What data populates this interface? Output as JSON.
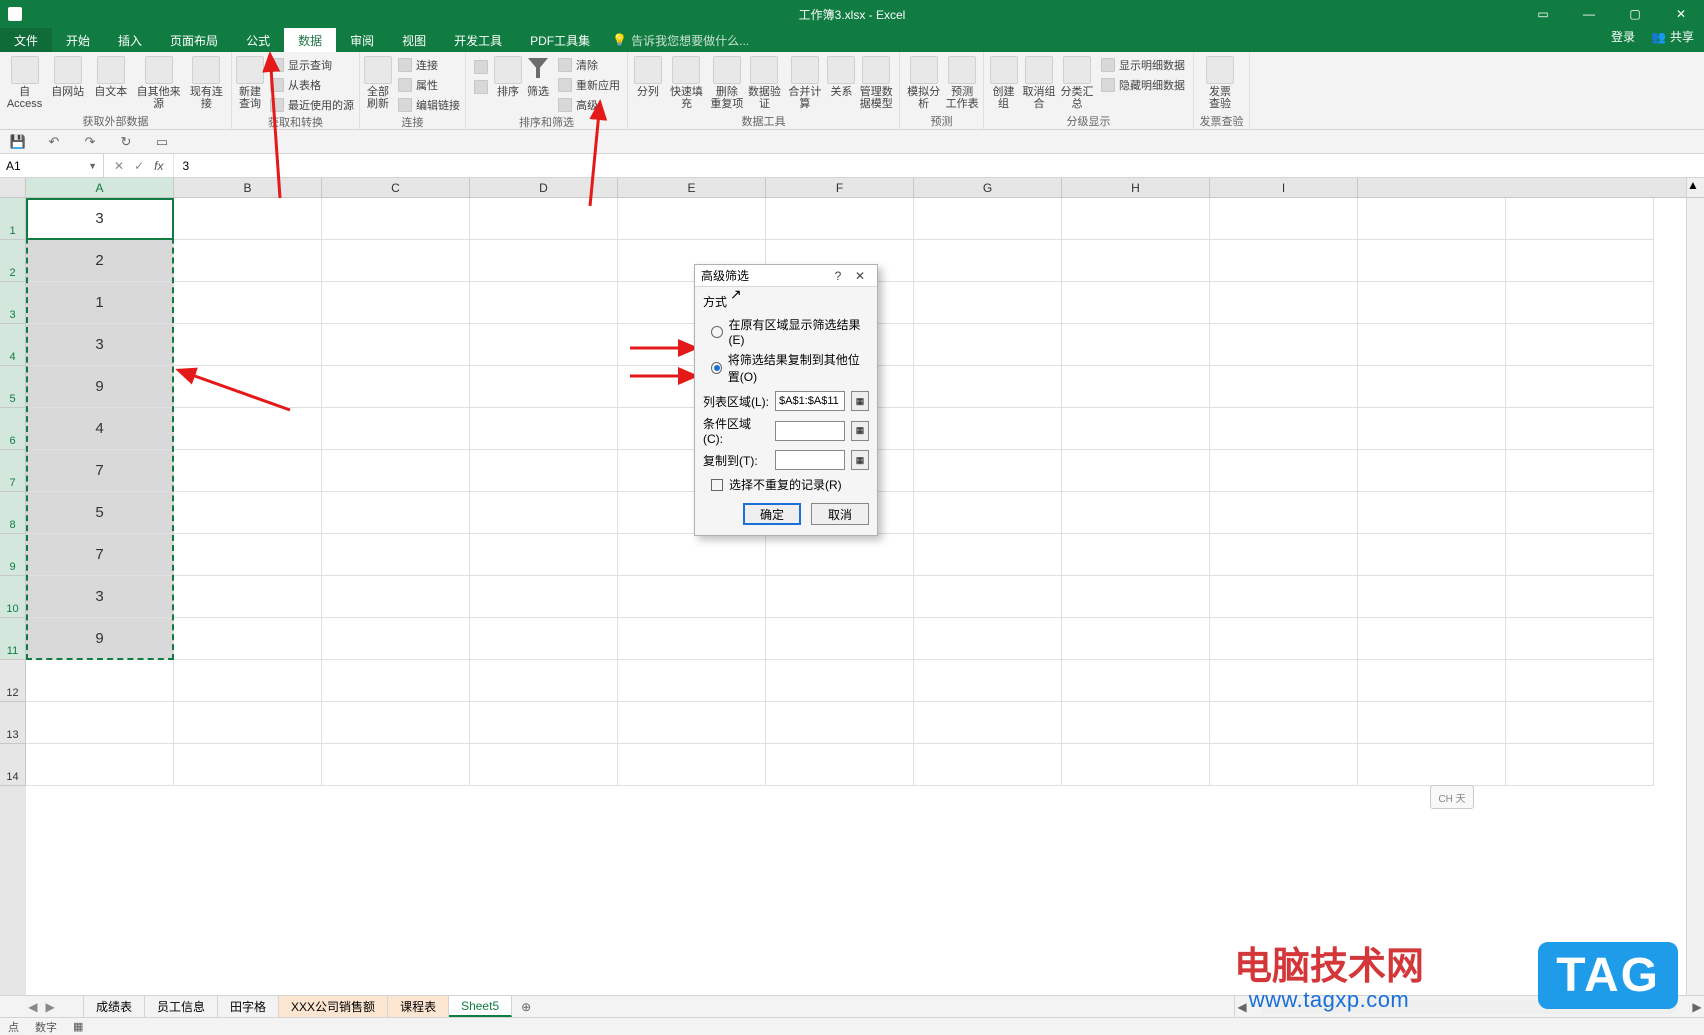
{
  "titlebar": {
    "title": "工作簿3.xlsx - Excel"
  },
  "win": {
    "min": "—",
    "max": "▢",
    "close": "✕"
  },
  "tabs": {
    "file": "文件",
    "items": [
      "开始",
      "插入",
      "页面布局",
      "公式",
      "数据",
      "审阅",
      "视图",
      "开发工具",
      "PDF工具集"
    ],
    "active_index": 4,
    "tellme_placeholder": "告诉我您想要做什么...",
    "login": "登录",
    "share": "共享"
  },
  "ribbon": {
    "g1": {
      "label": "获取外部数据",
      "btns": [
        "自 Access",
        "自网站",
        "自文本",
        "自其他来源",
        "现有连接"
      ]
    },
    "g2": {
      "label": "获取和转换",
      "big": "新建\n查询",
      "items": [
        "显示查询",
        "从表格",
        "最近使用的源"
      ]
    },
    "g3": {
      "label": "连接",
      "big": "全部刷新",
      "items": [
        "连接",
        "属性",
        "编辑链接"
      ]
    },
    "g4": {
      "label": "排序和筛选",
      "sort_az": "A→Z",
      "sort_za": "Z→A",
      "sort": "排序",
      "filter": "筛选",
      "items": [
        "清除",
        "重新应用",
        "高级"
      ]
    },
    "g5": {
      "label": "数据工具",
      "btns": [
        "分列",
        "快速填充",
        "删除\n重复项",
        "数据验\n证",
        "合并计算",
        "关系",
        "管理数\n据模型"
      ]
    },
    "g6": {
      "label": "预测",
      "btns": [
        "模拟分析",
        "预测\n工作表"
      ]
    },
    "g7": {
      "label": "分级显示",
      "btns": [
        "创建组",
        "取消组合",
        "分类汇总"
      ],
      "items": [
        "显示明细数据",
        "隐藏明细数据"
      ]
    },
    "g8": {
      "label": "发票查验",
      "big": "发票\n查验"
    }
  },
  "formula_bar": {
    "name": "A1",
    "value": "3"
  },
  "columns": [
    "A",
    "B",
    "C",
    "D",
    "E",
    "F",
    "G",
    "H",
    "I"
  ],
  "rows": [
    "1",
    "2",
    "3",
    "4",
    "5",
    "6",
    "7",
    "8",
    "9",
    "10",
    "11",
    "12",
    "13",
    "14"
  ],
  "colA": [
    "3",
    "2",
    "1",
    "3",
    "9",
    "4",
    "7",
    "5",
    "7",
    "3",
    "9"
  ],
  "dialog": {
    "title": "高级筛选",
    "section": "方式",
    "radio1": "在原有区域显示筛选结果(E)",
    "radio2": "将筛选结果复制到其他位置(O)",
    "list_label": "列表区域(L):",
    "list_value": "$A$1:$A$11",
    "cond_label": "条件区域(C):",
    "copy_label": "复制到(T):",
    "unique": "选择不重复的记录(R)",
    "ok": "确定",
    "cancel": "取消"
  },
  "sheets": {
    "nav": "◀ ▶",
    "tabs": [
      "成绩表",
      "员工信息",
      "田字格",
      "XXX公司销售额",
      "课程表",
      "Sheet5"
    ],
    "highlight_index": 3,
    "active_index": 5,
    "add": "⊕"
  },
  "status": {
    "left1": "点",
    "left2": "数字",
    "left3": "▦"
  },
  "watermark": {
    "line1": "电脑技术网",
    "url": "www.tagxp.com",
    "tag": "TAG"
  },
  "ime": "CH 天"
}
